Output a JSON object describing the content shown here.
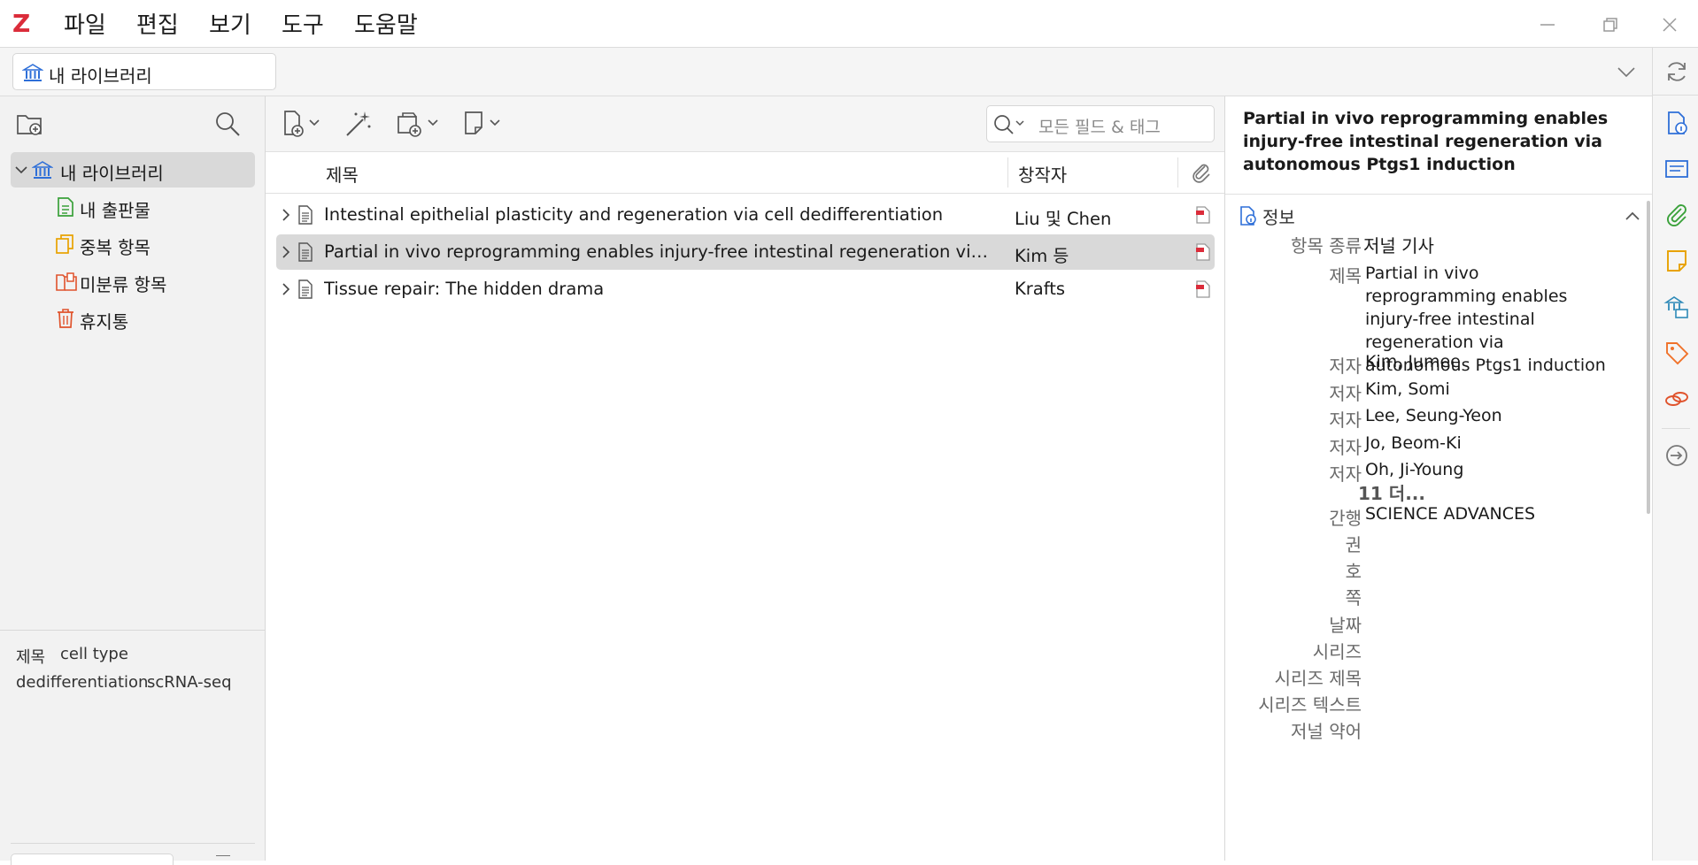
{
  "app": {
    "logo": "Z"
  },
  "menu": [
    "파일",
    "편집",
    "보기",
    "도구",
    "도움말"
  ],
  "library_tab": {
    "label": "내 라이브러리"
  },
  "collections": {
    "root": "내 라이브러리",
    "items": [
      "내 출판물",
      "중복 항목",
      "미분류 항목",
      "휴지통"
    ]
  },
  "tag_selector": {
    "tags": [
      "제목",
      "cell type",
      "dedifferentiation",
      "scRNA-seq"
    ]
  },
  "search": {
    "placeholder": "모든 필드 & 태그"
  },
  "columns": {
    "title": "제목",
    "creator": "창작자"
  },
  "items": [
    {
      "title": "Intestinal epithelial plasticity and regeneration via cell dedifferentiation",
      "creator": "Liu 및 Chen",
      "selected": false
    },
    {
      "title": "Partial in vivo reprogramming enables injury-free intestinal regeneration via auton...",
      "creator": "Kim 등",
      "selected": true
    },
    {
      "title": "Tissue repair: The hidden drama",
      "creator": "Krafts",
      "selected": false
    }
  ],
  "item_pane": {
    "heading": "Partial in vivo reprogramming enables injury-free intestinal regeneration via autonomous Ptgs1 induction",
    "section_title": "정보",
    "item_type_label": "항목 종류",
    "item_type": "저널 기사",
    "title_label": "제목",
    "title_value": "Partial in vivo reprogramming enables injury-free intestinal regeneration via autonomous Ptgs1 induction",
    "author_label": "저자",
    "authors": [
      "Kim, Jumee",
      "Kim, Somi",
      "Lee, Seung-Yeon",
      "Jo, Beom-Ki",
      "Oh, Ji-Young"
    ],
    "more_authors": "11 더...",
    "publication_label": "간행",
    "publication": "SCIENCE ADVANCES",
    "empty_fields": [
      "권",
      "호",
      "쪽",
      "날짜",
      "시리즈",
      "시리즈 제목",
      "시리즈 텍스트",
      "저널 약어"
    ]
  },
  "colors": {
    "accent": "#2e6fd8",
    "selected_row": "#d9d9d9",
    "logo": "#db2c3a"
  }
}
